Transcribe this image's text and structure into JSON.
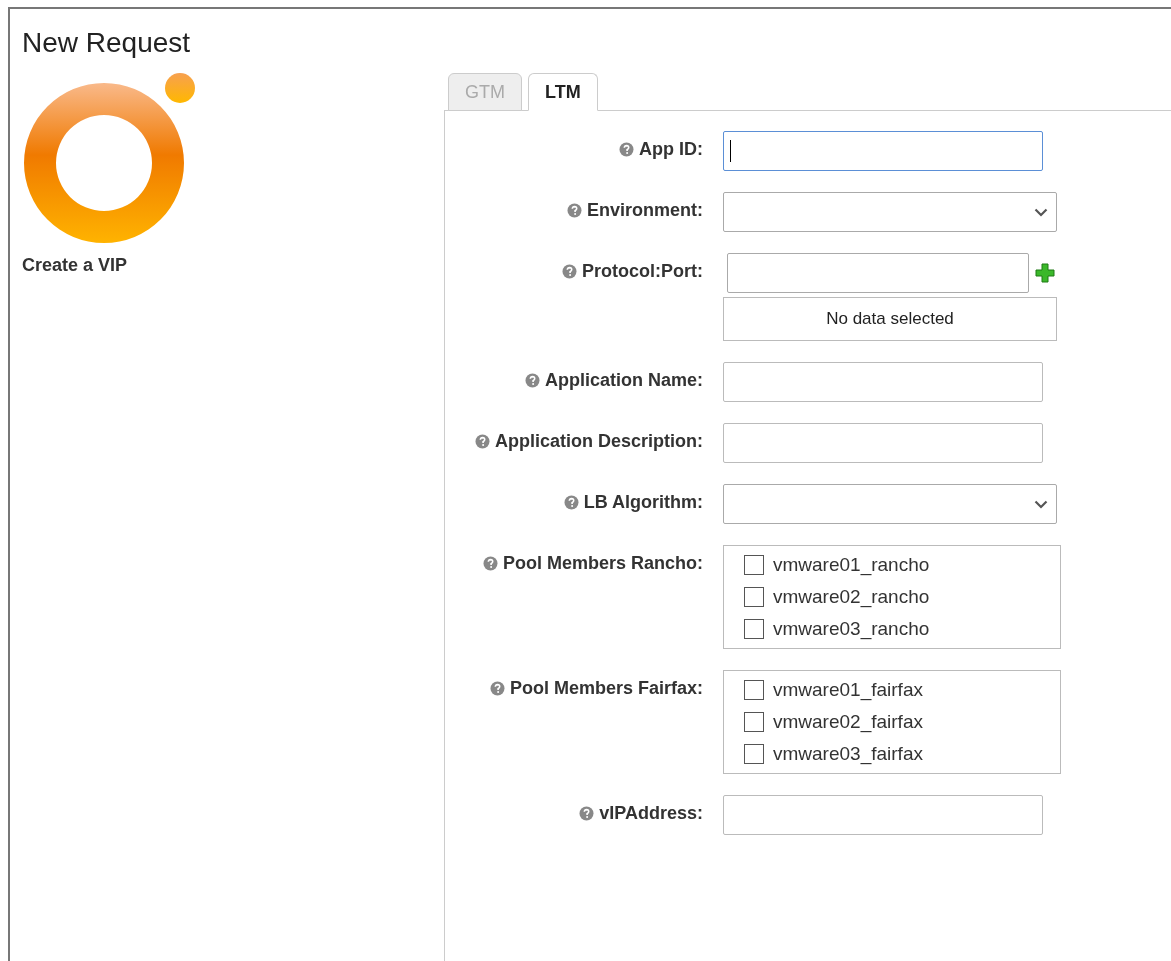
{
  "title": "New Request",
  "sidebar": {
    "caption": "Create a VIP"
  },
  "tabs": [
    {
      "label": "GTM",
      "selected": false
    },
    {
      "label": "LTM",
      "selected": true
    }
  ],
  "fields": [
    {
      "kind": "text",
      "label": "App ID:",
      "focused": true
    },
    {
      "kind": "select",
      "label": "Environment:"
    },
    {
      "kind": "protocol",
      "label": "Protocol:Port:",
      "empty_text": "No data selected"
    },
    {
      "kind": "text",
      "label": "Application Name:",
      "focused": false
    },
    {
      "kind": "text",
      "label": "Application Description:",
      "focused": false
    },
    {
      "kind": "select",
      "label": "LB Algorithm:"
    },
    {
      "kind": "checklist",
      "label": "Pool Members Rancho:",
      "options": [
        {
          "label": "vmware01_rancho",
          "checked": false
        },
        {
          "label": "vmware02_rancho",
          "checked": false
        },
        {
          "label": "vmware03_rancho",
          "checked": false
        }
      ]
    },
    {
      "kind": "checklist",
      "label": "Pool Members Fairfax:",
      "options": [
        {
          "label": "vmware01_fairfax",
          "checked": false
        },
        {
          "label": "vmware02_fairfax",
          "checked": false
        },
        {
          "label": "vmware03_fairfax",
          "checked": false
        }
      ]
    },
    {
      "kind": "text",
      "label": "vIPAddress:",
      "focused": false
    }
  ]
}
